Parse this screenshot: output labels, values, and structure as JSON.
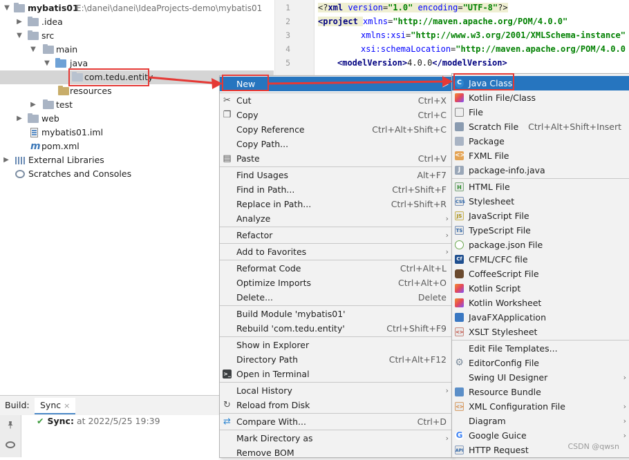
{
  "project_tree": {
    "root": {
      "name": "mybatis01",
      "path": "E:\\danei\\danei\\IdeaProjects-demo\\mybatis01"
    },
    "items": [
      {
        "label": "mybatis01",
        "icon": "module-folder-icon"
      },
      {
        "label": ".idea",
        "icon": "folder-icon"
      },
      {
        "label": "src",
        "icon": "folder-icon"
      },
      {
        "label": "main",
        "icon": "folder-icon"
      },
      {
        "label": "java",
        "icon": "source-folder-icon"
      },
      {
        "label": "com.tedu.entity",
        "icon": "package-icon"
      },
      {
        "label": "resources",
        "icon": "resources-folder-icon"
      },
      {
        "label": "test",
        "icon": "folder-icon"
      },
      {
        "label": "web",
        "icon": "folder-icon"
      },
      {
        "label": "mybatis01.iml",
        "icon": "iml-file-icon"
      },
      {
        "label": "pom.xml",
        "icon": "maven-icon"
      },
      {
        "label": "External Libraries",
        "icon": "library-icon"
      },
      {
        "label": "Scratches and Consoles",
        "icon": "scratch-icon"
      }
    ]
  },
  "editor": {
    "line_numbers": [
      "1",
      "2",
      "3",
      "4",
      "5"
    ],
    "lines": [
      [
        "<?",
        "xml ",
        "version",
        "=",
        "\"1.0\"",
        " ",
        "encoding",
        "=",
        "\"UTF-8\"",
        "?>"
      ],
      [
        "<",
        "project ",
        "xmlns",
        "=",
        "\"http://maven.apache.org/POM/4.0.0\""
      ],
      [
        "xmlns:xsi",
        "=",
        "\"http://www.w3.org/2001/XMLSchema-instance\""
      ],
      [
        "xsi:schemaLocation",
        "=",
        "\"http://maven.apache.org/POM/4.0.0 ht"
      ],
      [
        "<",
        "modelVersion",
        ">",
        "4.0.0",
        "</",
        "modelVersion",
        ">"
      ]
    ]
  },
  "build_panel": {
    "label": "Build:",
    "tab": "Sync",
    "tab_close": "×",
    "sync_title": "Sync:",
    "sync_time": "at 2022/5/25 19:39"
  },
  "context_menu": {
    "items": [
      {
        "label": "New",
        "shortcut": "",
        "submenu": true,
        "icon": ""
      },
      {
        "label": "Cut",
        "shortcut": "Ctrl+X",
        "icon": "scissors-icon"
      },
      {
        "label": "Copy",
        "shortcut": "Ctrl+C",
        "icon": "copy-icon"
      },
      {
        "label": "Copy Reference",
        "shortcut": "Ctrl+Alt+Shift+C",
        "icon": ""
      },
      {
        "label": "Copy Path...",
        "shortcut": "",
        "icon": ""
      },
      {
        "label": "Paste",
        "shortcut": "Ctrl+V",
        "icon": "paste-icon"
      },
      {
        "label": "Find Usages",
        "shortcut": "Alt+F7",
        "icon": ""
      },
      {
        "label": "Find in Path...",
        "shortcut": "Ctrl+Shift+F",
        "icon": ""
      },
      {
        "label": "Replace in Path...",
        "shortcut": "Ctrl+Shift+R",
        "icon": ""
      },
      {
        "label": "Analyze",
        "shortcut": "",
        "submenu": true,
        "icon": ""
      },
      {
        "label": "Refactor",
        "shortcut": "",
        "submenu": true,
        "icon": ""
      },
      {
        "label": "Add to Favorites",
        "shortcut": "",
        "submenu": true,
        "icon": ""
      },
      {
        "label": "Reformat Code",
        "shortcut": "Ctrl+Alt+L",
        "icon": ""
      },
      {
        "label": "Optimize Imports",
        "shortcut": "Ctrl+Alt+O",
        "icon": ""
      },
      {
        "label": "Delete...",
        "shortcut": "Delete",
        "icon": ""
      },
      {
        "label": "Build Module 'mybatis01'",
        "shortcut": "",
        "icon": ""
      },
      {
        "label": "Rebuild 'com.tedu.entity'",
        "shortcut": "Ctrl+Shift+F9",
        "icon": ""
      },
      {
        "label": "Show in Explorer",
        "shortcut": "",
        "icon": ""
      },
      {
        "label": "Directory Path",
        "shortcut": "Ctrl+Alt+F12",
        "icon": ""
      },
      {
        "label": "Open in Terminal",
        "shortcut": "",
        "icon": "terminal-icon"
      },
      {
        "label": "Local History",
        "shortcut": "",
        "submenu": true,
        "icon": ""
      },
      {
        "label": "Reload from Disk",
        "shortcut": "",
        "icon": "reload-icon"
      },
      {
        "label": "Compare With...",
        "shortcut": "Ctrl+D",
        "icon": "compare-icon"
      },
      {
        "label": "Mark Directory as",
        "shortcut": "",
        "submenu": true,
        "icon": ""
      },
      {
        "label": "Remove BOM",
        "shortcut": "",
        "icon": ""
      }
    ]
  },
  "new_submenu": {
    "items": [
      {
        "label": "Java Class",
        "shortcut": "",
        "icon": "class-icon",
        "glyph": "C"
      },
      {
        "label": "Kotlin File/Class",
        "shortcut": "",
        "icon": "kotlin-icon",
        "glyph": ""
      },
      {
        "label": "File",
        "shortcut": "",
        "icon": "file-icon",
        "glyph": ""
      },
      {
        "label": "Scratch File",
        "shortcut": "Ctrl+Alt+Shift+Insert",
        "icon": "scratch-file-icon",
        "glyph": ""
      },
      {
        "label": "Package",
        "shortcut": "",
        "icon": "package-icon",
        "glyph": ""
      },
      {
        "label": "FXML File",
        "shortcut": "",
        "icon": "fxml-icon",
        "glyph": "<>"
      },
      {
        "label": "package-info.java",
        "shortcut": "",
        "icon": "package-info-icon",
        "glyph": "J"
      },
      {
        "label": "HTML File",
        "shortcut": "",
        "icon": "html-icon",
        "glyph": "H"
      },
      {
        "label": "Stylesheet",
        "shortcut": "",
        "icon": "css-icon",
        "glyph": "CSS"
      },
      {
        "label": "JavaScript File",
        "shortcut": "",
        "icon": "javascript-icon",
        "glyph": "JS"
      },
      {
        "label": "TypeScript File",
        "shortcut": "",
        "icon": "typescript-icon",
        "glyph": "TS"
      },
      {
        "label": "package.json File",
        "shortcut": "",
        "icon": "npm-icon",
        "glyph": ""
      },
      {
        "label": "CFML/CFC file",
        "shortcut": "",
        "icon": "cfml-icon",
        "glyph": "Cf"
      },
      {
        "label": "CoffeeScript File",
        "shortcut": "",
        "icon": "coffeescript-icon",
        "glyph": ""
      },
      {
        "label": "Kotlin Script",
        "shortcut": "",
        "icon": "kotlin-script-icon",
        "glyph": ""
      },
      {
        "label": "Kotlin Worksheet",
        "shortcut": "",
        "icon": "kotlin-worksheet-icon",
        "glyph": ""
      },
      {
        "label": "JavaFXApplication",
        "shortcut": "",
        "icon": "javafx-icon",
        "glyph": ""
      },
      {
        "label": "XSLT Stylesheet",
        "shortcut": "",
        "icon": "xslt-icon",
        "glyph": "<>"
      },
      {
        "label": "Edit File Templates...",
        "shortcut": "",
        "icon": "",
        "glyph": ""
      },
      {
        "label": "EditorConfig File",
        "shortcut": "",
        "icon": "gear-icon",
        "glyph": "⚙"
      },
      {
        "label": "Swing UI Designer",
        "shortcut": "",
        "submenu": true,
        "icon": "",
        "glyph": ""
      },
      {
        "label": "Resource Bundle",
        "shortcut": "",
        "icon": "resource-bundle-icon",
        "glyph": ""
      },
      {
        "label": "XML Configuration File",
        "shortcut": "",
        "submenu": true,
        "icon": "xml-config-icon",
        "glyph": "<>"
      },
      {
        "label": "Diagram",
        "shortcut": "",
        "submenu": true,
        "icon": "",
        "glyph": ""
      },
      {
        "label": "Google Guice",
        "shortcut": "",
        "submenu": true,
        "icon": "google-icon",
        "glyph": "G"
      },
      {
        "label": "HTTP Request",
        "shortcut": "",
        "icon": "api-icon",
        "glyph": "API"
      }
    ]
  },
  "watermark": "CSDN @qwsn",
  "colors": {
    "menu_highlight": "#2675bf",
    "annotation_red": "#e53935",
    "selected_row": "#d5d5d5"
  }
}
